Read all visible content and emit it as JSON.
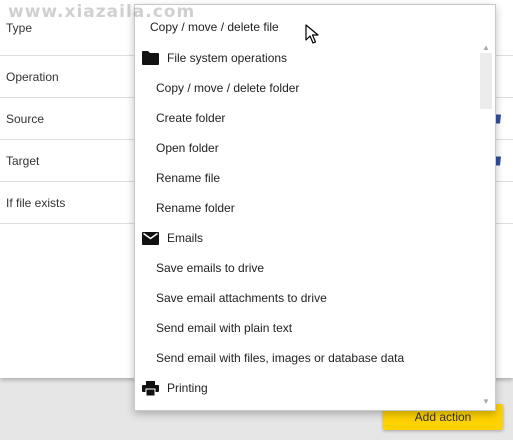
{
  "watermark": "www.xiazaila.com",
  "form": {
    "rows": [
      {
        "label": "Type"
      },
      {
        "label": "Operation"
      },
      {
        "label": "Source"
      },
      {
        "label": "Target"
      },
      {
        "label": "If file exists"
      }
    ]
  },
  "dropdown": {
    "selected": "Copy / move / delete file",
    "items": [
      {
        "kind": "group",
        "label": "File system operations",
        "icon": "folder-icon"
      },
      {
        "kind": "option",
        "label": "Copy / move / delete folder"
      },
      {
        "kind": "option",
        "label": "Create folder"
      },
      {
        "kind": "option",
        "label": "Open folder"
      },
      {
        "kind": "option",
        "label": "Rename file"
      },
      {
        "kind": "option",
        "label": "Rename folder"
      },
      {
        "kind": "group",
        "label": "Emails",
        "icon": "envelope-icon"
      },
      {
        "kind": "option",
        "label": "Save emails to drive"
      },
      {
        "kind": "option",
        "label": "Save email attachments to drive"
      },
      {
        "kind": "option",
        "label": "Send email with plain text"
      },
      {
        "kind": "option",
        "label": "Send email with files, images or database data"
      },
      {
        "kind": "group",
        "label": "Printing",
        "icon": "printer-icon"
      }
    ]
  },
  "buttons": {
    "add_action": "Add action"
  },
  "colors": {
    "accent_button": "#ffd200",
    "edge_icon": "#2f4fa0"
  }
}
